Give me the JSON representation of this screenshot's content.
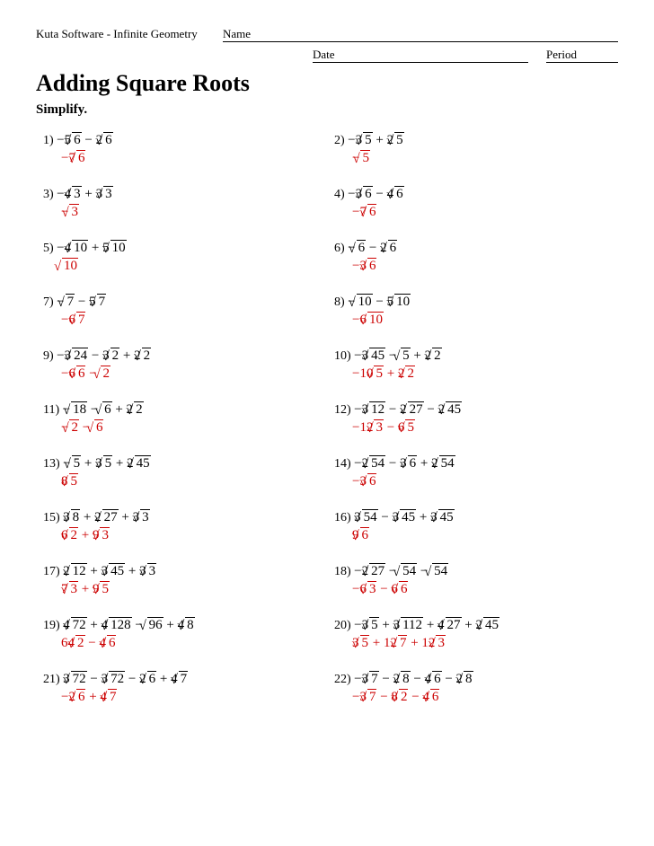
{
  "header": {
    "software": "Kuta Software - Infinite Geometry",
    "name_label": "Name",
    "date_label": "Date",
    "period_label": "Period"
  },
  "title": "Adding Square Roots",
  "instruction": "Simplify.",
  "problems": [
    {
      "num": "1)",
      "question": "−5√6 − 2√6",
      "answer": "−7√6"
    },
    {
      "num": "2)",
      "question": "−3√5 + 2√5",
      "answer": "−√5"
    },
    {
      "num": "3)",
      "question": "−4√3 + 3√3",
      "answer": "−√3"
    },
    {
      "num": "4)",
      "question": "−3√6 − 4√6",
      "answer": "−7√6"
    },
    {
      "num": "5)",
      "question": "−4√10 + 5√10",
      "answer": "√10"
    },
    {
      "num": "6)",
      "question": "−√6 − 2√6",
      "answer": "−3√6"
    },
    {
      "num": "7)",
      "question": "−√7 − 5√7",
      "answer": "−6√7"
    },
    {
      "num": "8)",
      "question": "−√10 − 5√10",
      "answer": "−6√10"
    },
    {
      "num": "9)",
      "question": "−3√24 − 3√2 + 2√2",
      "answer": "−6√6 − √2"
    },
    {
      "num": "10)",
      "question": "−3√45 − √5 + 2√2",
      "answer": "−10√5 + 2√2"
    },
    {
      "num": "11)",
      "question": "−√18 − √6 + 2√2",
      "answer": "−√2 − √6"
    },
    {
      "num": "12)",
      "question": "−3√12 − 2√27 − 2√45",
      "answer": "−12√3 − 6√5"
    },
    {
      "num": "13)",
      "question": "−√5 + 3√5 + 2√45",
      "answer": "8√5"
    },
    {
      "num": "14)",
      "question": "−2√54 − 3√6 + 2√54",
      "answer": "−3√6"
    },
    {
      "num": "15)",
      "question": "3√8 + 2√27 + 3√3",
      "answer": "6√2 + 9√3"
    },
    {
      "num": "16)",
      "question": "3√54 − 3√45 + 3√45",
      "answer": "9√6"
    },
    {
      "num": "17)",
      "question": "2√12 + 3√45 + 3√3",
      "answer": "7√3 + 9√5"
    },
    {
      "num": "18)",
      "question": "−2√27 − √54 − √54",
      "answer": "−6√3 − 6√6"
    },
    {
      "num": "19)",
      "question": "4√72 + 4√128 − √96 + 4√8",
      "answer": "64√2 − 4√6"
    },
    {
      "num": "20)",
      "question": "−3√5 + 3√112 + 4√27 + 2√45",
      "answer": "3√5 + 12√7 + 12√3"
    },
    {
      "num": "21)",
      "question": "3√72 − 3√72 − 2√6 + 4√7",
      "answer": "−2√6 + 4√7"
    },
    {
      "num": "22)",
      "question": "−3√7 − 2√8 − 4√6 − 2√8",
      "answer": "−3√7 − 8√2 − 4√6"
    }
  ]
}
